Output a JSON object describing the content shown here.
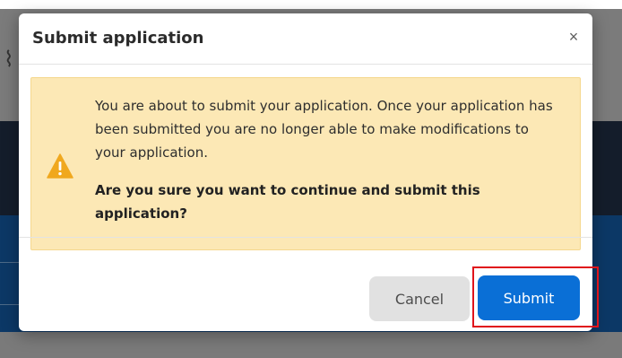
{
  "modal": {
    "title": "Submit application",
    "close_label": "×",
    "alert": {
      "message": "You are about to submit your application. Once your application has been submitted you are no longer able to make modifications to your application.",
      "question": "Are you sure you want to continue and submit this application?",
      "icon": "warning-icon",
      "icon_color": "#f0a81e"
    },
    "buttons": {
      "cancel_label": "Cancel",
      "submit_label": "Submit"
    }
  },
  "colors": {
    "alert_background": "#fce8b5",
    "submit_button": "#0a6fd6",
    "cancel_button": "#e1e1e1",
    "highlight": "#e0141b"
  }
}
